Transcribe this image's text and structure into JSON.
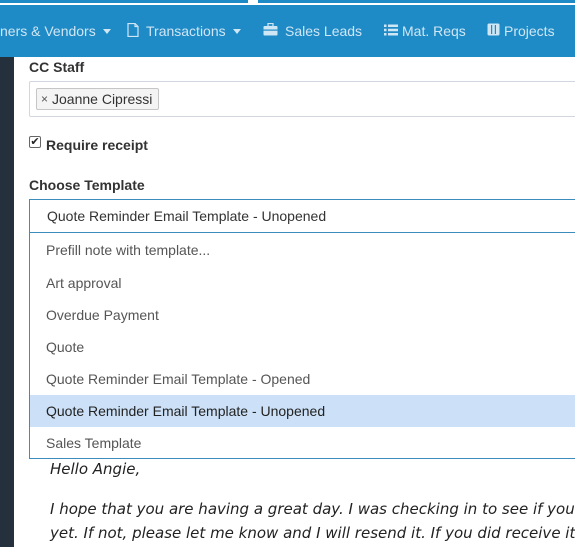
{
  "nav": {
    "items": [
      {
        "label": "ners & Vendors",
        "icon": "people-icon",
        "dropdown": true
      },
      {
        "label": "Transactions",
        "icon": "document-icon",
        "dropdown": true
      },
      {
        "label": "Sales Leads",
        "icon": "briefcase-icon",
        "dropdown": false
      },
      {
        "label": "Mat. Reqs",
        "icon": "list-icon",
        "dropdown": false
      },
      {
        "label": "Projects",
        "icon": "columns-icon",
        "dropdown": false
      }
    ]
  },
  "form": {
    "cc_staff_label": "CC Staff",
    "cc_tag": "Joanne Cipressi",
    "cc_tag_remove": "×",
    "require_receipt_label": "Require receipt",
    "require_receipt_checked": true,
    "choose_template_label": "Choose Template",
    "selected_template": "Quote Reminder Email Template - Unopened",
    "template_options": [
      "Prefill note with template...",
      "Art approval",
      "Overdue Payment",
      "Quote",
      "Quote Reminder Email Template - Opened",
      "Quote Reminder Email Template - Unopened",
      "Sales Template"
    ]
  },
  "email": {
    "greeting": "Hello Angie,",
    "line1": "I hope that you are having a great day.  I was checking in to see if you re",
    "line2": "yet. If not, please let me know and I will resend it. If you did receive it,"
  },
  "colors": {
    "navbar": "#1e8ac6",
    "sidebar": "#24313d",
    "selected_option": "#cce1f7",
    "focus_border": "#3c8dbc"
  }
}
